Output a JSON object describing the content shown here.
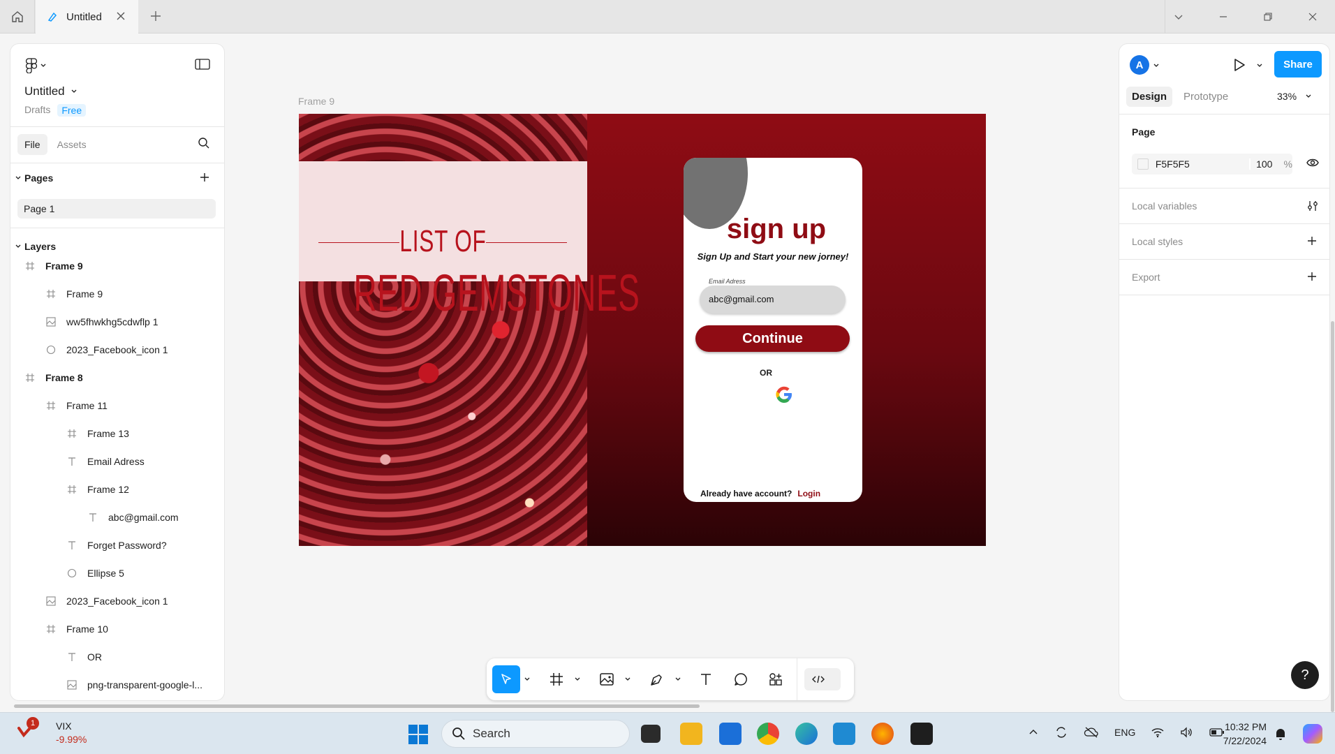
{
  "titlebar": {
    "tab_title": "Untitled"
  },
  "left_panel": {
    "file_title": "Untitled",
    "drafts": "Drafts",
    "plan": "Free",
    "tabs": [
      "File",
      "Assets"
    ],
    "pages_heading": "Pages",
    "pages": [
      "Page 1"
    ],
    "layers_heading": "Layers",
    "layers": [
      {
        "label": "Frame 9",
        "icon": "frame-icon"
      },
      {
        "label": "Frame 9",
        "icon": "frame-icon"
      },
      {
        "label": "ww5fhwkhg5cdwflp 1",
        "icon": "image-icon"
      },
      {
        "label": "2023_Facebook_icon 1",
        "icon": "ellipse-icon"
      },
      {
        "label": "Frame 8",
        "icon": "frame-icon"
      },
      {
        "label": "Frame 11",
        "icon": "frame-icon"
      },
      {
        "label": "Frame 13",
        "icon": "frame-icon"
      },
      {
        "label": "Email Adress",
        "icon": "text-icon"
      },
      {
        "label": "Frame 12",
        "icon": "frame-icon"
      },
      {
        "label": "abc@gmail.com",
        "icon": "text-icon"
      },
      {
        "label": "Forget Password?",
        "icon": "text-icon"
      },
      {
        "label": "Ellipse 5",
        "icon": "ellipse-icon"
      },
      {
        "label": "2023_Facebook_icon 1",
        "icon": "image-icon"
      },
      {
        "label": "Frame 10",
        "icon": "frame-icon"
      },
      {
        "label": "OR",
        "icon": "text-icon"
      },
      {
        "label": "png-transparent-google-l...",
        "icon": "image-icon"
      }
    ]
  },
  "canvas": {
    "frame_label": "Frame 9",
    "gem_listof": "LIST OF",
    "gem_title": "RED GEMSTONES",
    "card": {
      "title": "sign up",
      "subtitle": "Sign Up and Start your new jorney!",
      "email_label": "Email Adress",
      "email_value": "abc@gmail.com",
      "continue": "Continue",
      "or": "OR",
      "already": "Already have account?",
      "login": "Login"
    }
  },
  "right_panel": {
    "avatar_initial": "A",
    "share": "Share",
    "tabs": [
      "Design",
      "Prototype"
    ],
    "zoom": "33%",
    "page_heading": "Page",
    "page_color": "F5F5F5",
    "page_opacity": "100",
    "percent": "%",
    "local_variables": "Local variables",
    "local_styles": "Local styles",
    "export": "Export",
    "help": "?"
  },
  "taskbar": {
    "vix_badge": "1",
    "vix_label": "VIX",
    "vix_change": "-9.99%",
    "search": "Search",
    "lang": "ENG",
    "time": "10:32 PM",
    "date": "7/22/2024"
  },
  "colors": {
    "accent": "#0d99ff",
    "brand_red": "#8f0c14",
    "page_bg": "#F5F5F5"
  }
}
